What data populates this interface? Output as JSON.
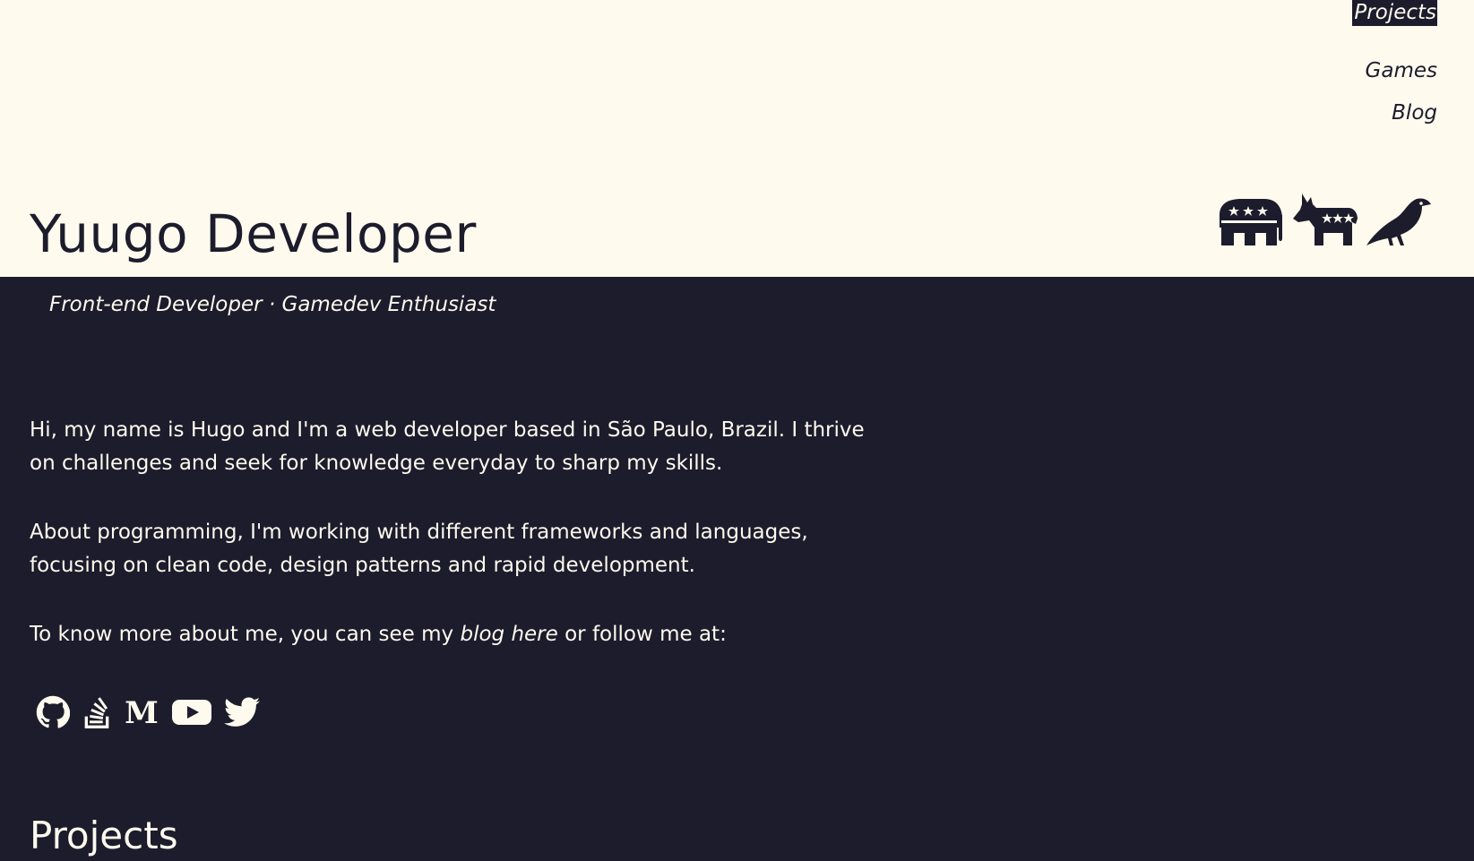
{
  "nav": {
    "items": [
      {
        "label": "Projects",
        "active": true
      },
      {
        "label": "Games",
        "active": false
      },
      {
        "label": "Blog",
        "active": false
      }
    ]
  },
  "header": {
    "title": "Yuugo Developer",
    "icons": [
      "republican-elephant-icon",
      "democrat-donkey-icon",
      "crow-icon"
    ]
  },
  "tagline": "Front-end Developer · Gamedev Enthusiast",
  "about": {
    "p1": "Hi, my name is Hugo and I'm a web developer based in São Paulo, Brazil. I thrive on challenges and seek for knowledge everyday to sharp my skills.",
    "p2": "About programming, I'm working with different frameworks and languages, focusing on clean code, design patterns and rapid development.",
    "p3_before": "To know more about me, you can see my ",
    "p3_link": "blog here",
    "p3_after": " or follow me at:"
  },
  "social": [
    "github-icon",
    "stackoverflow-icon",
    "medium-icon",
    "youtube-icon",
    "twitter-icon"
  ],
  "projects_heading": "Projects",
  "colors": {
    "dark": "#1c1c2c",
    "cream": "#fefaee"
  }
}
